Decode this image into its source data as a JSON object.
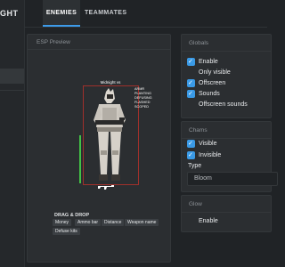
{
  "app": {
    "brand": "GHT"
  },
  "tabs": [
    {
      "label": "ENEMIES",
      "active": true
    },
    {
      "label": "TEAMMATES",
      "active": false
    }
  ],
  "esp_preview": {
    "title": "ESP Preview",
    "player_name": "Midnight vs",
    "flags": [
      "ARMR",
      "PLANTING",
      "DEFUSING",
      "FLASHED",
      "SCOPED"
    ],
    "health_color": "#42c246",
    "box_color": "#a0302b"
  },
  "drag_drop": {
    "title": "DRAG & DROP",
    "chips": [
      "Money",
      "Ammo bar",
      "Distance",
      "Weapon name",
      "Defuse kits"
    ]
  },
  "globals": {
    "title": "Globals",
    "options": [
      {
        "label": "Enable",
        "checked": true
      },
      {
        "label": "Only visible",
        "checked": false
      },
      {
        "label": "Offscreen",
        "checked": true
      },
      {
        "label": "Sounds",
        "checked": true
      },
      {
        "label": "Offscreen sounds",
        "checked": false
      }
    ]
  },
  "chams": {
    "title": "Chams",
    "options": [
      {
        "label": "Visible",
        "checked": true
      },
      {
        "label": "Invisible",
        "checked": true
      }
    ],
    "type_label": "Type",
    "type_value": "Bloom"
  },
  "glow": {
    "title": "Glow",
    "options": [
      {
        "label": "Enable",
        "checked": false
      }
    ]
  },
  "accent_color": "#3a9ae6"
}
